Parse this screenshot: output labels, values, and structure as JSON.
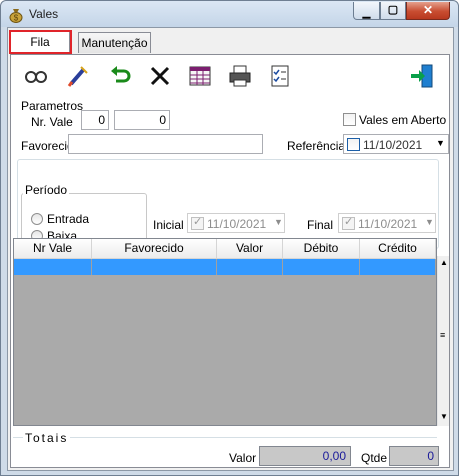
{
  "window": {
    "title": "Vales"
  },
  "tabs": [
    {
      "label": "Fila"
    },
    {
      "label": "Manutenção"
    }
  ],
  "toolbar": {
    "icons": [
      "search-icon",
      "edit-icon",
      "undo-icon",
      "delete-icon",
      "grid-icon",
      "print-icon",
      "checklist-icon",
      "exit-icon"
    ]
  },
  "params": {
    "section_label": "Parametros",
    "nr_vale_label": "Nr. Vale",
    "nr_vale_from": "0",
    "nr_vale_to": "0",
    "vales_em_aberto_label": "Vales em Aberto",
    "favorecido_label": "Favorecido",
    "favorecido_value": "",
    "referencia_label": "Referência",
    "referencia_date": "11/10/2021"
  },
  "periodo": {
    "label": "Período",
    "entrada_label": "Entrada",
    "baixa_label": "Baixa",
    "inicial_label": "Inicial",
    "inicial_date": "11/10/2021",
    "final_label": "Final",
    "final_date": "11/10/2021"
  },
  "table": {
    "columns": [
      "Nr Vale",
      "Favorecido",
      "Valor",
      "Débito",
      "Crédito"
    ]
  },
  "totais": {
    "label": "Totais",
    "valor_label": "Valor",
    "valor_value": "0,00",
    "qtde_label": "Qtde",
    "qtde_value": "0"
  }
}
